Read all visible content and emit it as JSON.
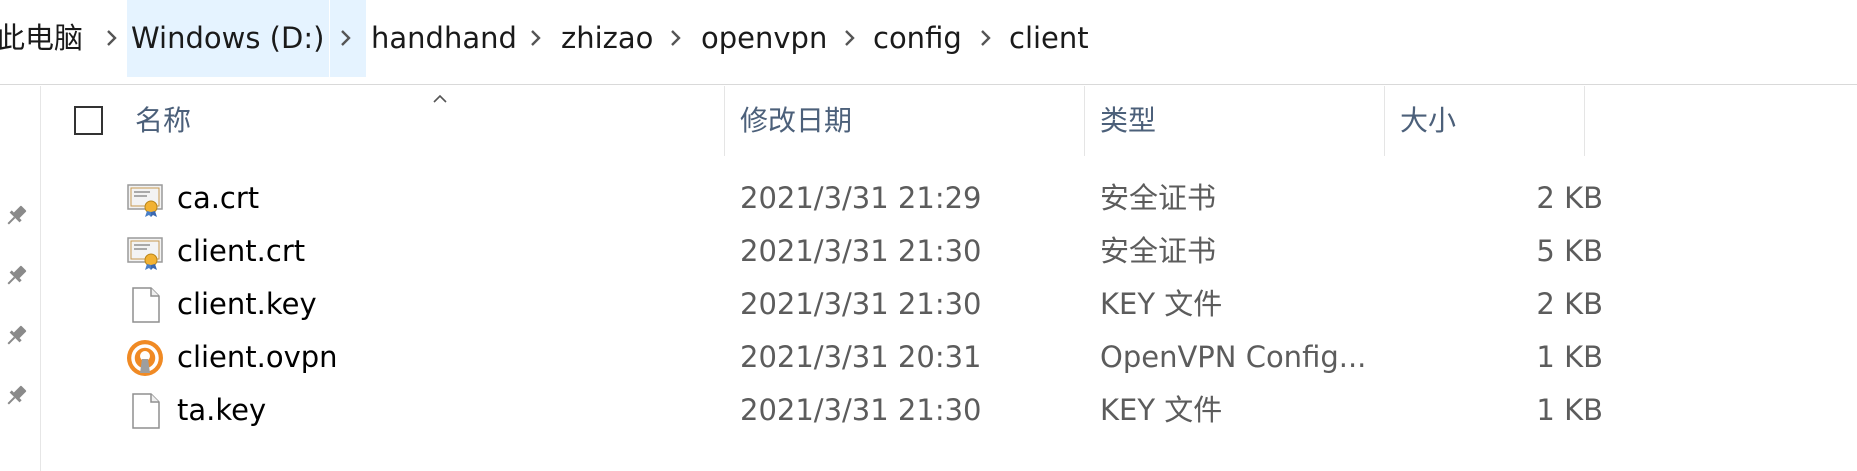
{
  "breadcrumb": {
    "items": [
      "此电脑",
      "Windows (D:)",
      "handhand",
      "zhizao",
      "openvpn",
      "config",
      "client"
    ]
  },
  "columns": {
    "name": "名称",
    "modified": "修改日期",
    "type": "类型",
    "size": "大小"
  },
  "files": [
    {
      "name": "ca.crt",
      "modified": "2021/3/31 21:29",
      "type": "安全证书",
      "size": "2 KB",
      "icon": "certificate-icon"
    },
    {
      "name": "client.crt",
      "modified": "2021/3/31 21:30",
      "type": "安全证书",
      "size": "5 KB",
      "icon": "certificate-icon"
    },
    {
      "name": "client.key",
      "modified": "2021/3/31 21:30",
      "type": "KEY 文件",
      "size": "2 KB",
      "icon": "blank-file-icon"
    },
    {
      "name": "client.ovpn",
      "modified": "2021/3/31 20:31",
      "type": "OpenVPN Config...",
      "size": "1 KB",
      "icon": "openvpn-icon"
    },
    {
      "name": "ta.key",
      "modified": "2021/3/31 21:30",
      "type": "KEY 文件",
      "size": "1 KB",
      "icon": "blank-file-icon"
    }
  ],
  "colors": {
    "header_text": "#4c607a",
    "selected_crumb": "#e5f3ff",
    "secondary_text": "#5c5c5c",
    "openvpn_orange": "#f08a24"
  }
}
